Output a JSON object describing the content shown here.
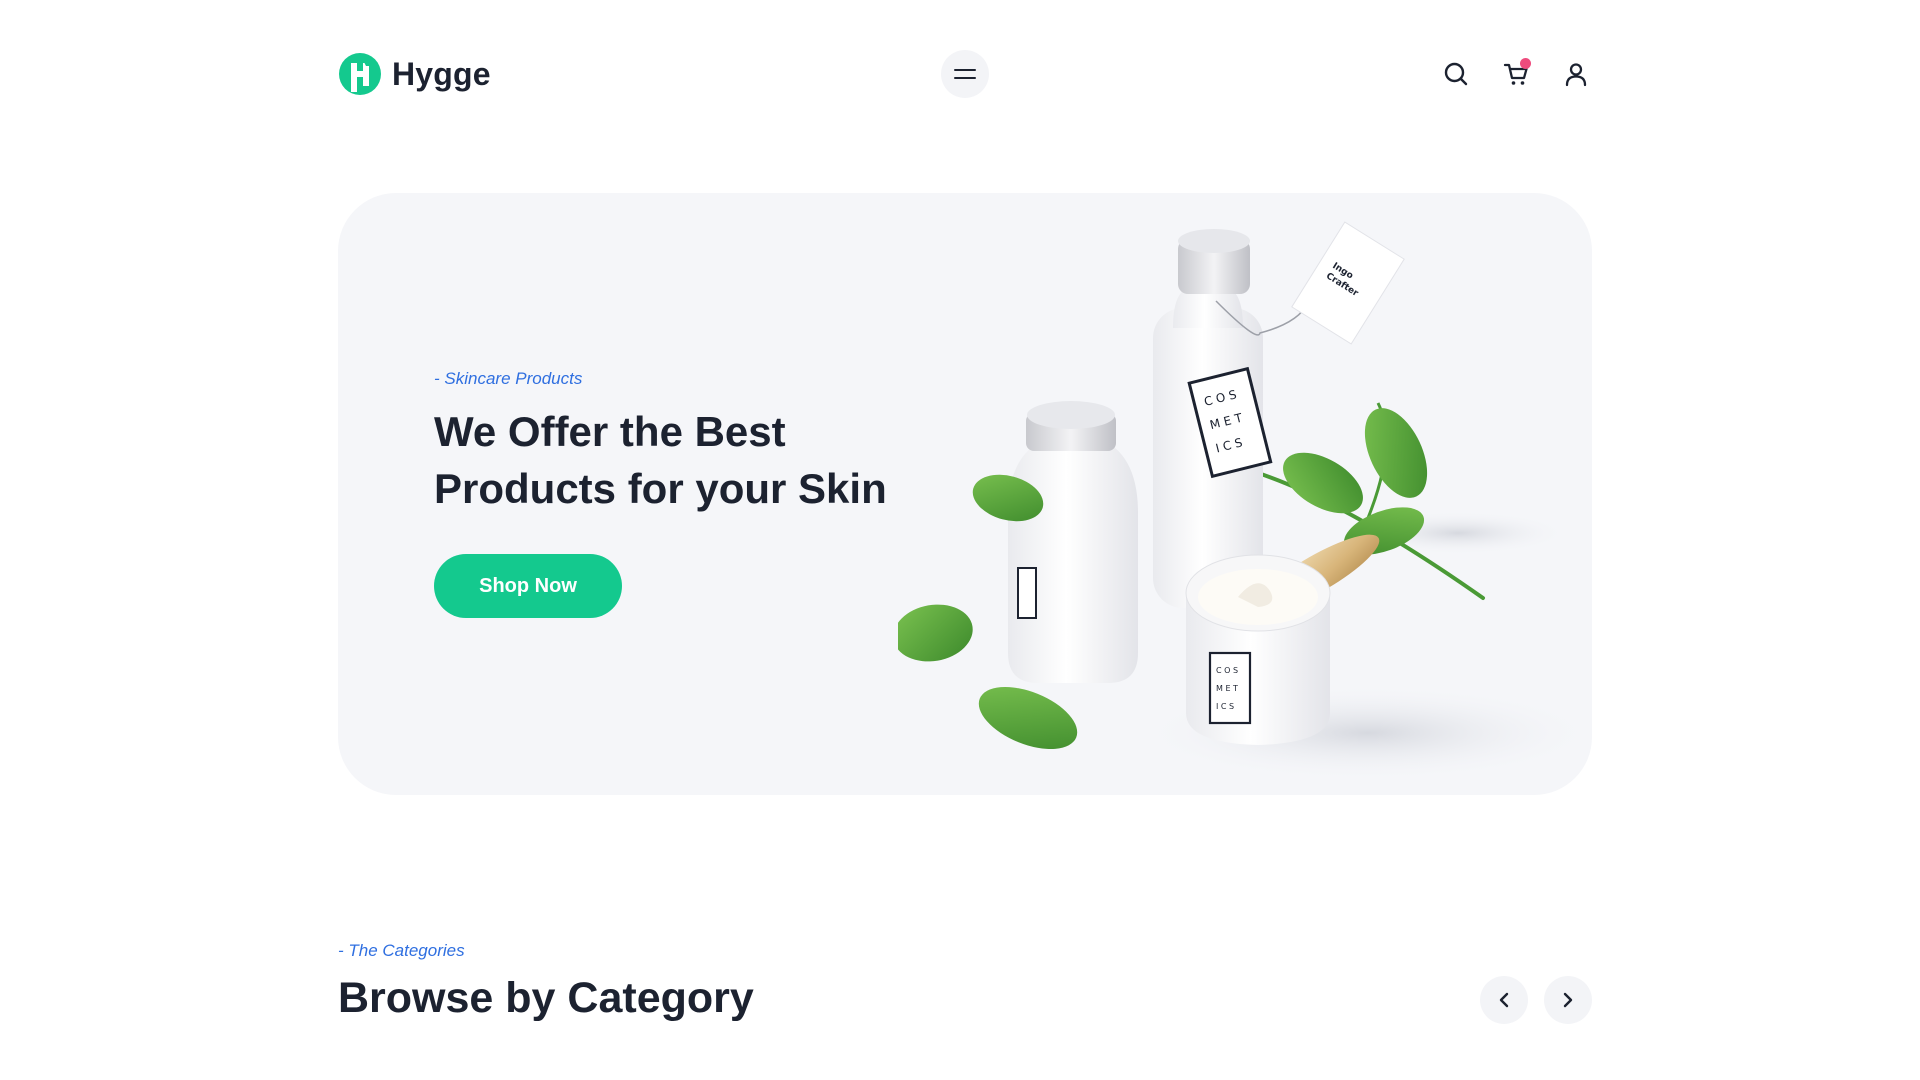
{
  "header": {
    "brand_name": "Hygge",
    "logo_icon": "hygge-logo-icon",
    "menu_icon": "hamburger-menu-icon",
    "icons": [
      "search-icon",
      "cart-icon",
      "user-icon"
    ],
    "cart_badge_color": "#ee4b7d"
  },
  "hero": {
    "eyebrow": "- Skincare Products",
    "title": "We Offer the Best Products for your Skin",
    "cta_label": "Shop Now",
    "image": "cosmetics-bottles-and-leaves-illustration",
    "jar_label": "C O S M E T I C S",
    "tag_label": "Ingo Crafter"
  },
  "categories": {
    "eyebrow": "- The Categories",
    "title": "Browse by Category",
    "prev_icon": "chevron-left-icon",
    "next_icon": "chevron-right-icon"
  },
  "colors": {
    "accent_green": "#14c98e",
    "accent_blue": "#2f6fe0",
    "text_dark": "#1c2230",
    "hero_bg": "#f5f6f9"
  }
}
